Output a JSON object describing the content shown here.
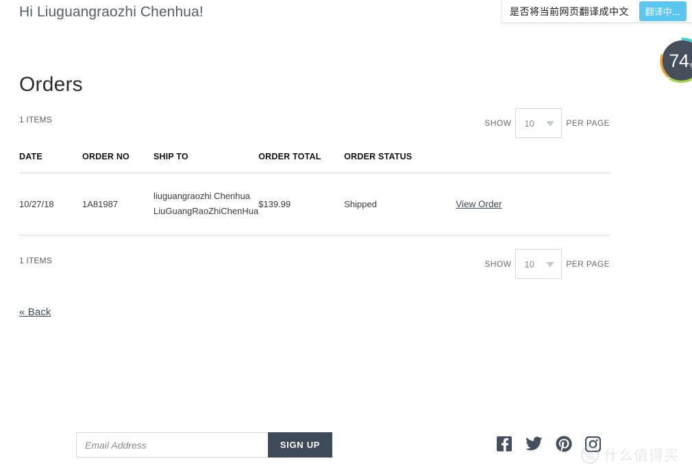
{
  "translate_bar": {
    "message": "是否将当前网页翻译成中文",
    "button_label": "翻译中...",
    "button_color": "#5bc7f0"
  },
  "score_widget": {
    "value": "74",
    "unit": "%",
    "ring_colors": [
      "#2fd2c6",
      "#a8d44a",
      "#e8a33d"
    ],
    "background_color": "#454f5b"
  },
  "greeting": "Hi Liuguangraozhi Chenhua!",
  "page_title": "Orders",
  "toolbar_top": {
    "items_count": "1 ITEMS",
    "show_label": "SHOW",
    "per_page_value": "10",
    "per_page_label": "PER PAGE"
  },
  "toolbar_bottom": {
    "items_count": "1 ITEMS",
    "show_label": "SHOW",
    "per_page_value": "10",
    "per_page_label": "PER PAGE"
  },
  "table": {
    "headers": [
      "DATE",
      "ORDER NO",
      "SHIP TO",
      "ORDER TOTAL",
      "ORDER STATUS",
      ""
    ],
    "rows": [
      {
        "date": "10/27/18",
        "order_no": "1A81987",
        "ship_to_line1": "liuguangraozhi Chenhua",
        "ship_to_line2": "LiuGuangRaoZhiChenHua",
        "order_total": "$139.99",
        "order_status": "Shipped",
        "action_label": "View Order"
      }
    ]
  },
  "back_link": "« Back",
  "newsletter": {
    "placeholder": "Email Address",
    "value": "",
    "button_label": "SIGN UP",
    "button_color": "#3f4a58"
  },
  "social": [
    {
      "name": "facebook-icon"
    },
    {
      "name": "twitter-icon"
    },
    {
      "name": "pinterest-icon"
    },
    {
      "name": "instagram-icon"
    }
  ],
  "watermark": {
    "badge": "值",
    "text": "什么值得买"
  }
}
